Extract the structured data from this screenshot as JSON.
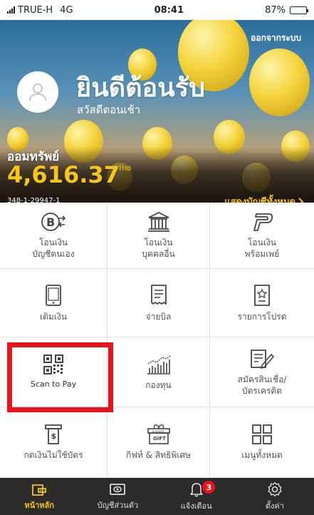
{
  "status_bar": {
    "carrier": "TRUE-H",
    "network": "4G",
    "time": "08:41",
    "battery": "87%",
    "battery_level": 0.87
  },
  "header": {
    "logout": "ออกจากระบบ",
    "welcome": "ยินดีต้อนรับ",
    "greeting": "สวัสดีตอนเช้า",
    "account_name": "ออมทรัพย์",
    "balance": "4,616.37",
    "currency": "THB",
    "account_number": "348-1-29947-1",
    "show_all": "แสดงบัญชีทั้งหมด"
  },
  "menu": [
    {
      "icon": "baht-transfer-icon",
      "lines": [
        "โอนเงิน",
        "บัญชีตนเอง"
      ]
    },
    {
      "icon": "bank-icon",
      "lines": [
        "โอนเงิน",
        "บุคคลอื่น"
      ]
    },
    {
      "icon": "promptpay-icon",
      "lines": [
        "โอนเงิน",
        "พร้อมเพย์"
      ]
    },
    {
      "icon": "mobile-topup-icon",
      "lines": [
        "เติมเงิน"
      ]
    },
    {
      "icon": "bill-icon",
      "lines": [
        "จ่ายบิล"
      ]
    },
    {
      "icon": "favorite-list-icon",
      "lines": [
        "รายการโปรด"
      ]
    },
    {
      "icon": "qr-code-icon",
      "lines": [
        "Scan to Pay"
      ]
    },
    {
      "icon": "fund-chart-icon",
      "lines": [
        "กองทุน"
      ]
    },
    {
      "icon": "loan-form-icon",
      "lines": [
        "สมัครสินเชื่อ/",
        "บัตรเครดิต"
      ]
    },
    {
      "icon": "cardless-atm-icon",
      "lines": [
        "กดเงินไม่ใช้บัตร"
      ]
    },
    {
      "icon": "gift-icon",
      "lines": [
        "กิฟท์ & สิทธิพิเศษ"
      ],
      "gift_text": "GIFT",
      "gift_brand": "krungsri"
    },
    {
      "icon": "all-menu-icon",
      "lines": [
        "เมนูทั้งหมด"
      ]
    }
  ],
  "tabs": [
    {
      "icon": "home-wallet-icon",
      "label": "หน้าหลัก",
      "active": true
    },
    {
      "icon": "account-card-icon",
      "label": "บัญชีส่วนตัว"
    },
    {
      "icon": "bell-icon",
      "label": "แจ้งเตือน",
      "badge": "3"
    },
    {
      "icon": "settings-icon",
      "label": "ตั้งค่า"
    }
  ],
  "colors": {
    "accent": "#f5c518",
    "highlight": "#e8141c",
    "tabbar": "#2b2b2b"
  }
}
